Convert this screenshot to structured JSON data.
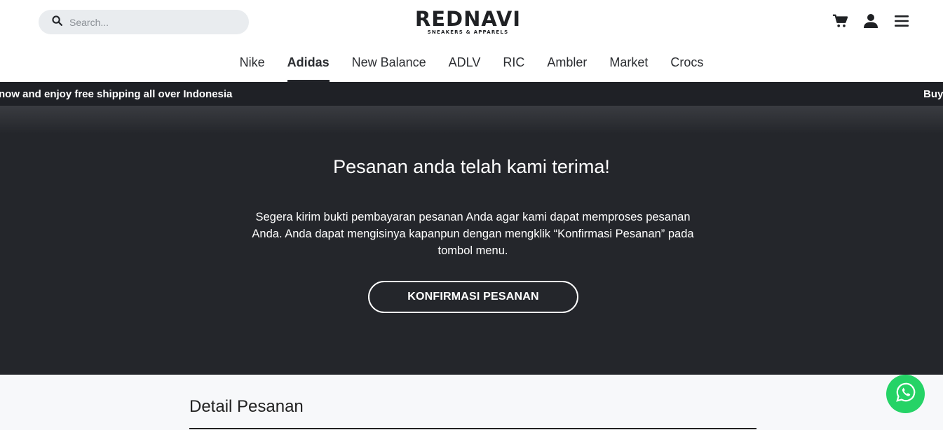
{
  "header": {
    "search_placeholder": "Search...",
    "logo_main": "REDNAVI",
    "logo_sub": "SNEAKERS & APPARELS",
    "icons": [
      "cart-icon",
      "user-icon",
      "menu-icon"
    ]
  },
  "nav": {
    "items": [
      "Nike",
      "Adidas",
      "New Balance",
      "ADLV",
      "RIC",
      "Ambler",
      "Market",
      "Crocs"
    ],
    "active": "Adidas"
  },
  "marquee": {
    "text_left": "now and enjoy free shipping all over Indonesia",
    "text_right": "Buy"
  },
  "hero": {
    "title": "Pesanan anda telah kami terima!",
    "description": "Segera kirim bukti pembayaran pesanan Anda agar kami dapat memproses pesanan Anda. Anda dapat mengisinya kapanpun dengan mengklik “Konfirmasi Pesanan” pada tombol menu.",
    "button_label": "KONFIRMASI PESANAN"
  },
  "detail": {
    "title": "Detail Pesanan"
  },
  "floating": {
    "icon": "whatsapp-icon",
    "color": "#25d366"
  },
  "colors": {
    "dark_bg": "#24262b",
    "marquee_bg": "#1f2126",
    "search_bg": "#e9ecef"
  }
}
